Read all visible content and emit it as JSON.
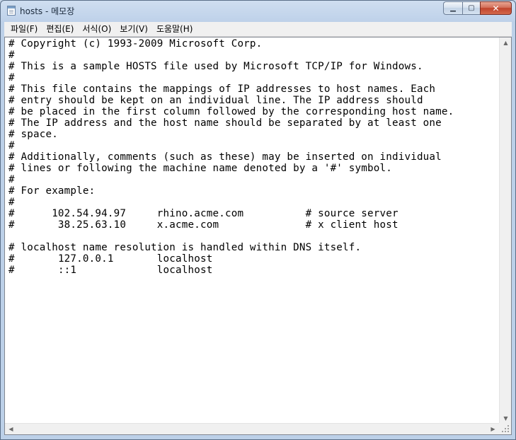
{
  "window": {
    "title": "hosts - 메모장",
    "minimize_glyph": "▁",
    "maximize_glyph": "▢",
    "close_glyph": "✕"
  },
  "menu": [
    {
      "label": "파일(F)"
    },
    {
      "label": "편집(E)"
    },
    {
      "label": "서식(O)"
    },
    {
      "label": "보기(V)"
    },
    {
      "label": "도움말(H)"
    }
  ],
  "document": {
    "content": "# Copyright (c) 1993-2009 Microsoft Corp.\n#\n# This is a sample HOSTS file used by Microsoft TCP/IP for Windows.\n#\n# This file contains the mappings of IP addresses to host names. Each\n# entry should be kept on an individual line. The IP address should\n# be placed in the first column followed by the corresponding host name.\n# The IP address and the host name should be separated by at least one\n# space.\n#\n# Additionally, comments (such as these) may be inserted on individual\n# lines or following the machine name denoted by a '#' symbol.\n#\n# For example:\n#\n#      102.54.94.97     rhino.acme.com          # source server\n#       38.25.63.10     x.acme.com              # x client host\n\n# localhost name resolution is handled within DNS itself.\n#\t127.0.0.1       localhost\n#\t::1             localhost"
  },
  "scrollbars": {
    "up_arrow": "▲",
    "down_arrow": "▼",
    "left_arrow": "◀",
    "right_arrow": "▶"
  }
}
